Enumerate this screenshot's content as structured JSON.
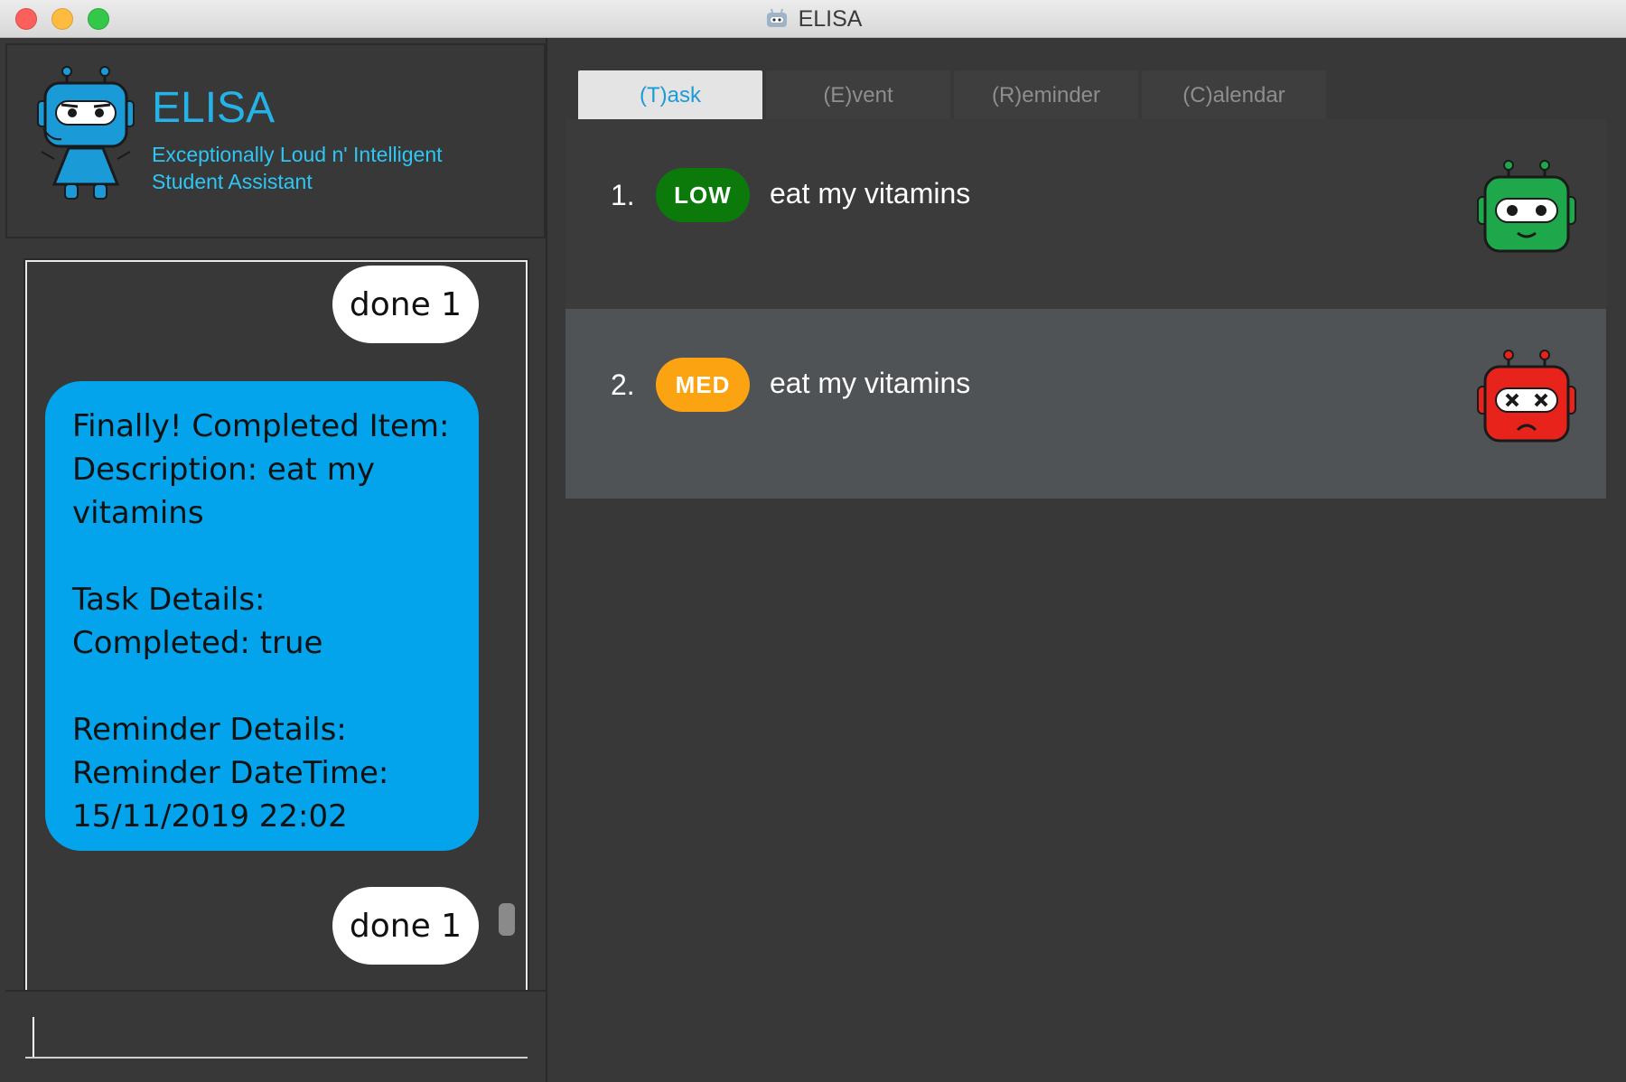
{
  "window": {
    "title": "ELISA"
  },
  "header": {
    "app_name": "ELISA",
    "subtitle_line1": "Exceptionally Loud n' Intelligent",
    "subtitle_line2": "Student Assistant"
  },
  "chat": {
    "messages": [
      {
        "role": "user",
        "text": "done 1"
      },
      {
        "role": "bot",
        "lines": [
          "Finally! Completed Item:",
          "Description: eat my",
          "vitamins",
          "",
          "Task Details:",
          "Completed: true",
          "",
          "Reminder Details:",
          "Reminder DateTime:",
          "15/11/2019 22:02"
        ]
      },
      {
        "role": "user",
        "text": "done 1"
      }
    ]
  },
  "input": {
    "value": "",
    "placeholder": ""
  },
  "tabs": [
    {
      "label": "(T)ask",
      "active": true
    },
    {
      "label": "(E)vent",
      "active": false
    },
    {
      "label": "(R)eminder",
      "active": false
    },
    {
      "label": "(C)alendar",
      "active": false
    }
  ],
  "tasks": [
    {
      "index": "1.",
      "priority": "LOW",
      "description": "eat my vitamins",
      "status_icon": "happy-green-robot-icon",
      "color": "#0b7a0b"
    },
    {
      "index": "2.",
      "priority": "MED",
      "description": "eat my vitamins",
      "status_icon": "sad-red-robot-icon",
      "color": "#fca311"
    }
  ],
  "colors": {
    "accent": "#25b2e6",
    "bot_bubble": "#03a4ec",
    "background": "#383838"
  }
}
